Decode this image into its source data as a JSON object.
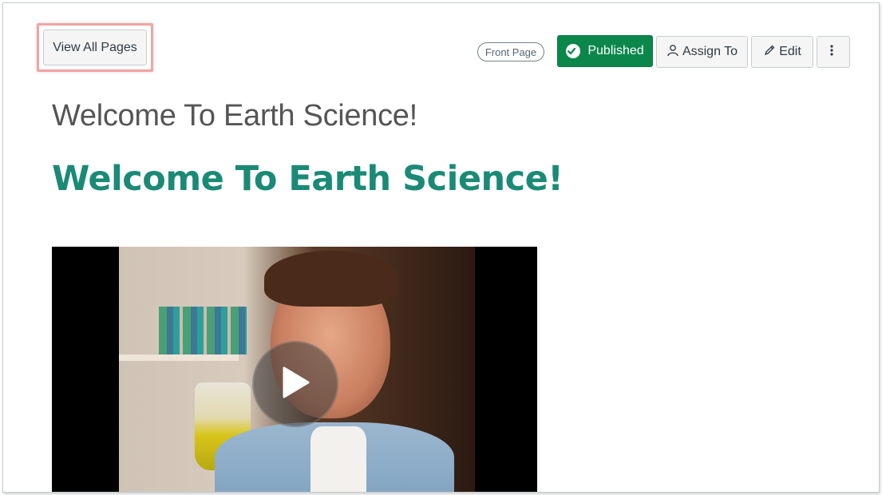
{
  "toolbar": {
    "view_all_pages": "View All Pages",
    "front_page_badge": "Front Page",
    "published_label": "Published",
    "assign_to_label": "Assign To",
    "edit_label": "Edit"
  },
  "page": {
    "title": "Welcome To Earth Science!",
    "content_heading": "Welcome To Earth Science!"
  },
  "colors": {
    "published": "#0b874b",
    "heading": "#1a8a76",
    "highlight": "#f2a3a3"
  },
  "icons": {
    "published": "check-circle-icon",
    "assign": "user-icon",
    "edit": "pencil-icon",
    "more": "kebab-menu-icon",
    "video": "play-icon"
  }
}
